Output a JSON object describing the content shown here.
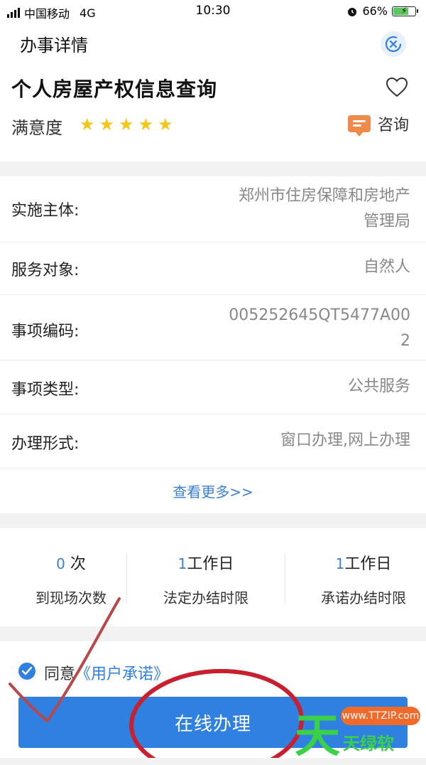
{
  "status": {
    "carrier": "中国移动",
    "network": "4G",
    "time": "10:30",
    "battery": "66%"
  },
  "nav": {
    "title": "办事详情"
  },
  "service": {
    "name": "个人房屋产权信息查询",
    "satisfaction_label": "满意度",
    "rating": 5,
    "consult_label": "咨询"
  },
  "info": {
    "rows": [
      {
        "label": "实施主体:",
        "value_lines": [
          "郑州市住房保障和房地产",
          "管理局"
        ]
      },
      {
        "label": "服务对象:",
        "value_lines": [
          "自然人"
        ]
      },
      {
        "label": "事项编码:",
        "value_lines": [
          "005252645QT5477A00",
          "2"
        ]
      },
      {
        "label": "事项类型:",
        "value_lines": [
          "公共服务"
        ]
      },
      {
        "label": "办理形式:",
        "value_lines": [
          "窗口办理,网上办理"
        ]
      }
    ],
    "more": "查看更多>>"
  },
  "stats": [
    {
      "num": "0",
      "unit": " 次",
      "caption": "到现场次数"
    },
    {
      "num": "1",
      "unit": "工作日",
      "caption": "法定办结时限"
    },
    {
      "num": "1",
      "unit": "工作日",
      "caption": "承诺办结时限"
    }
  ],
  "agree": {
    "prefix": "同意",
    "link": "《用户承诺》"
  },
  "button": {
    "label": "在线办理"
  },
  "watermark": {
    "big": "天",
    "pill": "www.TTZIP.com",
    "small": "天绿软"
  }
}
